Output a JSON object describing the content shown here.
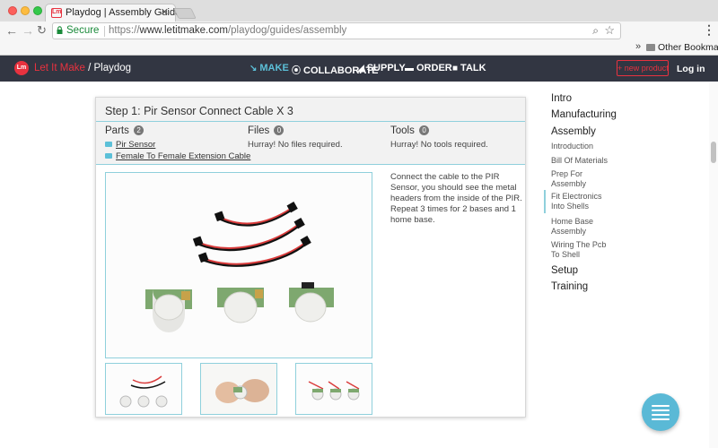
{
  "browser": {
    "tab_title": "Playdog | Assembly Guide",
    "tab_favicon": "Lm",
    "secure_label": "Secure",
    "url_scheme": "https://",
    "url_host": "www.letitmake.com",
    "url_path": "/playdog/guides/assembly",
    "bookmarks_label": "Other Bookmarks"
  },
  "site": {
    "logo_mark": "Lm",
    "logo_brand": "Let It Make",
    "logo_sep": " / ",
    "logo_project": "Playdog",
    "nav": [
      {
        "label": "MAKE",
        "icon": "wrench-icon",
        "active": true
      },
      {
        "label": "COLLABORATE",
        "icon": "flask-icon",
        "active": false
      },
      {
        "label": "SUPPLY",
        "icon": "cart-icon",
        "active": false
      },
      {
        "label": "ORDER",
        "icon": "truck-icon",
        "active": false
      },
      {
        "label": "TALK",
        "icon": "chat-icon",
        "active": false
      }
    ],
    "new_product_label": "+ new product",
    "login_label": "Log in"
  },
  "step": {
    "title": "Step 1: Pir Sensor Connect Cable X 3",
    "parts_label": "Parts",
    "parts_count": "2",
    "parts": [
      "Pir Sensor",
      "Female To Female Extension Cable"
    ],
    "files_label": "Files",
    "files_count": "0",
    "files_text": "Hurray! No files required.",
    "tools_label": "Tools",
    "tools_count": "0",
    "tools_text": "Hurray! No tools required.",
    "description": [
      "Connect the cable to the PIR Sensor, you should see the metal headers from the inside of the PIR.",
      "Repeat 3 times for 2 bases and 1 home base."
    ]
  },
  "sidebar": {
    "sections": [
      {
        "label": "Intro"
      },
      {
        "label": "Manufacturing"
      },
      {
        "label": "Assembly"
      }
    ],
    "assembly_items": [
      "Introduction",
      "Bill Of Materials",
      "Prep For Assembly",
      "Fit Electronics Into Shells",
      "Home Base Assembly",
      "Wiring The Pcb To Shell"
    ],
    "active_item": "Fit Electronics Into Shells",
    "trailing_sections": [
      {
        "label": "Setup"
      },
      {
        "label": "Training"
      }
    ]
  },
  "colors": {
    "accent": "#e8323f",
    "teal": "#5cc0d8",
    "navbar": "#323642"
  }
}
